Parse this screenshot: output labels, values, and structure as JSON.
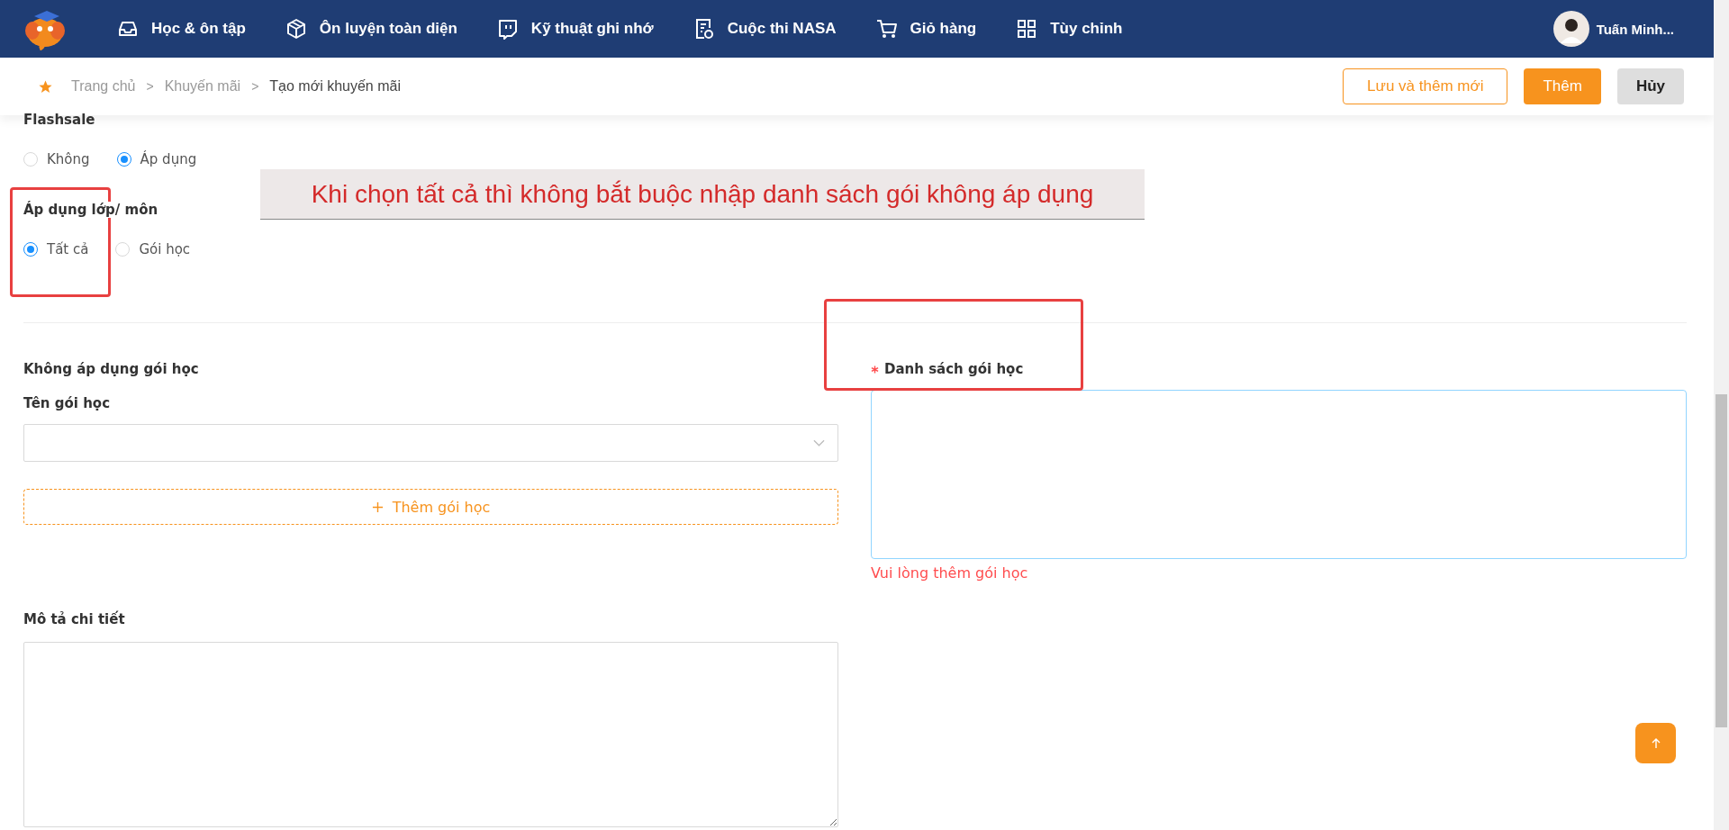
{
  "nav": {
    "items": [
      {
        "label": "Học & ôn tập",
        "kind": "inbox"
      },
      {
        "label": "Ôn luyện toàn diện",
        "kind": "cube"
      },
      {
        "label": "Kỹ thuật ghi nhớ",
        "kind": "chat"
      },
      {
        "label": "Cuộc thi NASA",
        "kind": "doc"
      },
      {
        "label": "Giỏ hàng",
        "kind": "cart"
      },
      {
        "label": "Tùy chỉnh",
        "kind": "grid"
      }
    ],
    "user": {
      "name": "Tuấn Minh..."
    }
  },
  "breadcrumb": [
    {
      "label": "Trang chủ",
      "current": false
    },
    {
      "label": "Khuyến mãi",
      "current": false
    },
    {
      "label": "Tạo mới khuyến mãi",
      "current": true
    }
  ],
  "breadcrumb_separators": [
    ">",
    ">"
  ],
  "actions": [
    {
      "label": "Lưu và thêm mới",
      "kind": "outline"
    },
    {
      "label": "Thêm",
      "kind": "primary"
    },
    {
      "label": "Hủy",
      "kind": "plain"
    }
  ],
  "flashsale": {
    "label": "Flashsale",
    "options": [
      {
        "label": "Không",
        "selected": false
      },
      {
        "label": "Áp dụng",
        "selected": true
      }
    ]
  },
  "scope": {
    "label": "Áp dụng lớp/ môn",
    "options": [
      {
        "label": "Tất cả",
        "selected": true
      },
      {
        "label": "Gói học",
        "selected": false
      }
    ]
  },
  "annotation": {
    "note": "Khi chọn tất cả thì không bắt buộc nhập danh sách gói không áp dụng"
  },
  "excluded": {
    "title": "Không áp dụng gói học",
    "field_label": "Tên gói học",
    "add_button": "Thêm gói học"
  },
  "package_list": {
    "label": "Danh sách gói học",
    "required": true,
    "error": "Vui lòng thêm gói học"
  },
  "description": {
    "label": "Mô tả chi tiết"
  }
}
